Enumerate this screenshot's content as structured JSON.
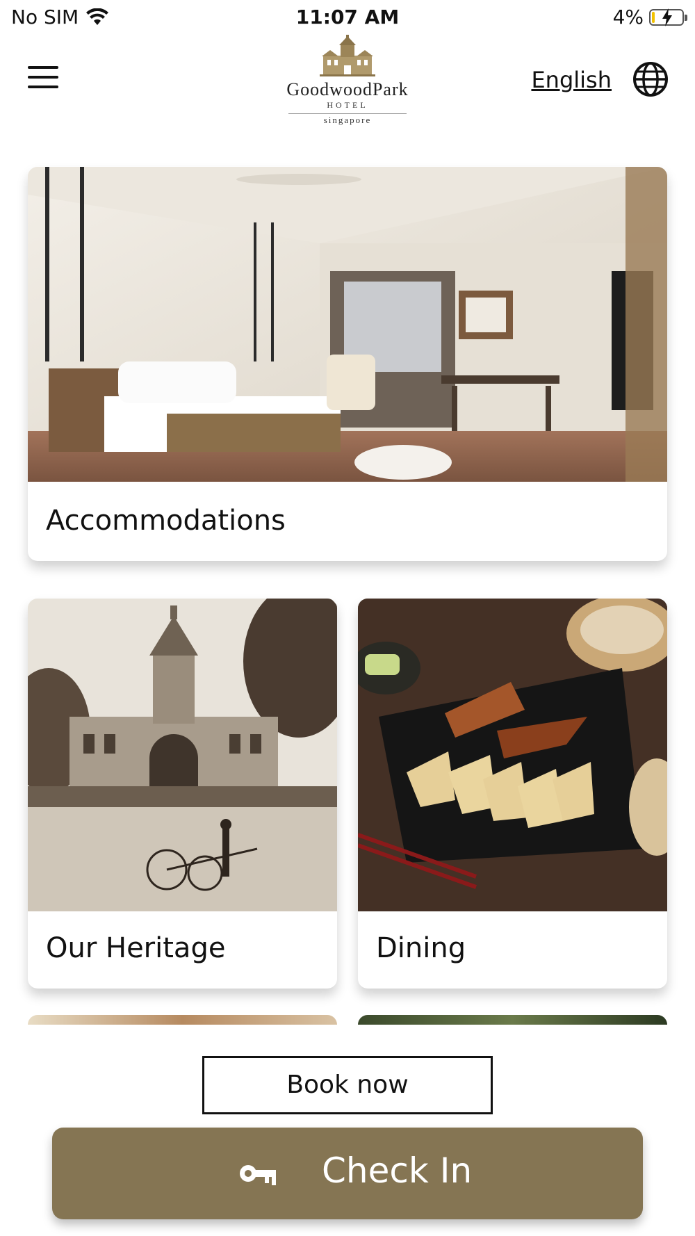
{
  "status_bar": {
    "carrier": "No SIM",
    "time": "11:07 AM",
    "battery_percent": "4%"
  },
  "header": {
    "logo": {
      "name": "GoodwoodPark",
      "sub": "HOTEL",
      "city": "singapore"
    },
    "language": "English",
    "menu_icon": "hamburger-icon",
    "globe_icon": "globe-icon"
  },
  "cards": [
    {
      "label": "Accommodations"
    },
    {
      "label": "Our Heritage"
    },
    {
      "label": "Dining"
    }
  ],
  "actions": {
    "book_now": "Book now",
    "check_in": "Check In",
    "check_in_icon": "key-icon"
  },
  "colors": {
    "accent": "#857553",
    "text": "#111111",
    "background": "#ffffff"
  }
}
